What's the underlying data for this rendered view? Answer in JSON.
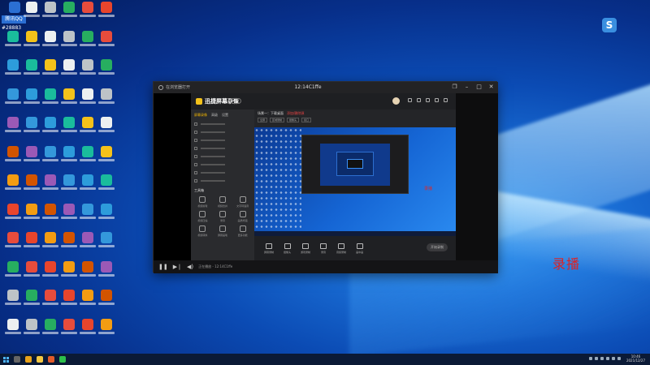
{
  "desktop": {
    "selected_icon_label": "腾讯QQ",
    "selected_icon_subtext": "#28883",
    "overlay_label": "录播",
    "tray_app_letter": "S"
  },
  "window": {
    "title": "12:14C1ffe",
    "left_label": "在浏览器打开",
    "controls": [
      "❐",
      "–",
      "□",
      "✕"
    ]
  },
  "recorder": {
    "brand": "迅捷屏幕录像",
    "badge": "VIP",
    "side_tabs": [
      "屏幕录像",
      "高级",
      "设置"
    ],
    "tools_title": "工具箱",
    "tools": [
      "视频剪辑",
      "视频合并",
      "文字转语音",
      "视频压缩",
      "录音",
      "画质增强",
      "视频转换",
      "屏幕画笔",
      "更多功能"
    ],
    "scene_title": "场景一：下载桌面",
    "scene_red": "添加/删除源",
    "scene_tabs": [
      "全屏",
      "区域录制",
      "摄像头",
      "窗口"
    ],
    "preview_red_text": "录播",
    "bottom_tools": [
      "屏幕录制",
      "摄像头",
      "游戏录制",
      "录音",
      "音频录制",
      "画中画"
    ],
    "record_button": "开始录制"
  },
  "player": {
    "status_text": "正在播放 - 12:14C1ffe"
  },
  "taskbar": {
    "clock_time": "10:46",
    "clock_date": "2021/12/27"
  },
  "colors": {
    "accent_red": "#e02020",
    "brand_yellow": "#f4c21a",
    "desktop_blue": "#0b4bb4"
  }
}
